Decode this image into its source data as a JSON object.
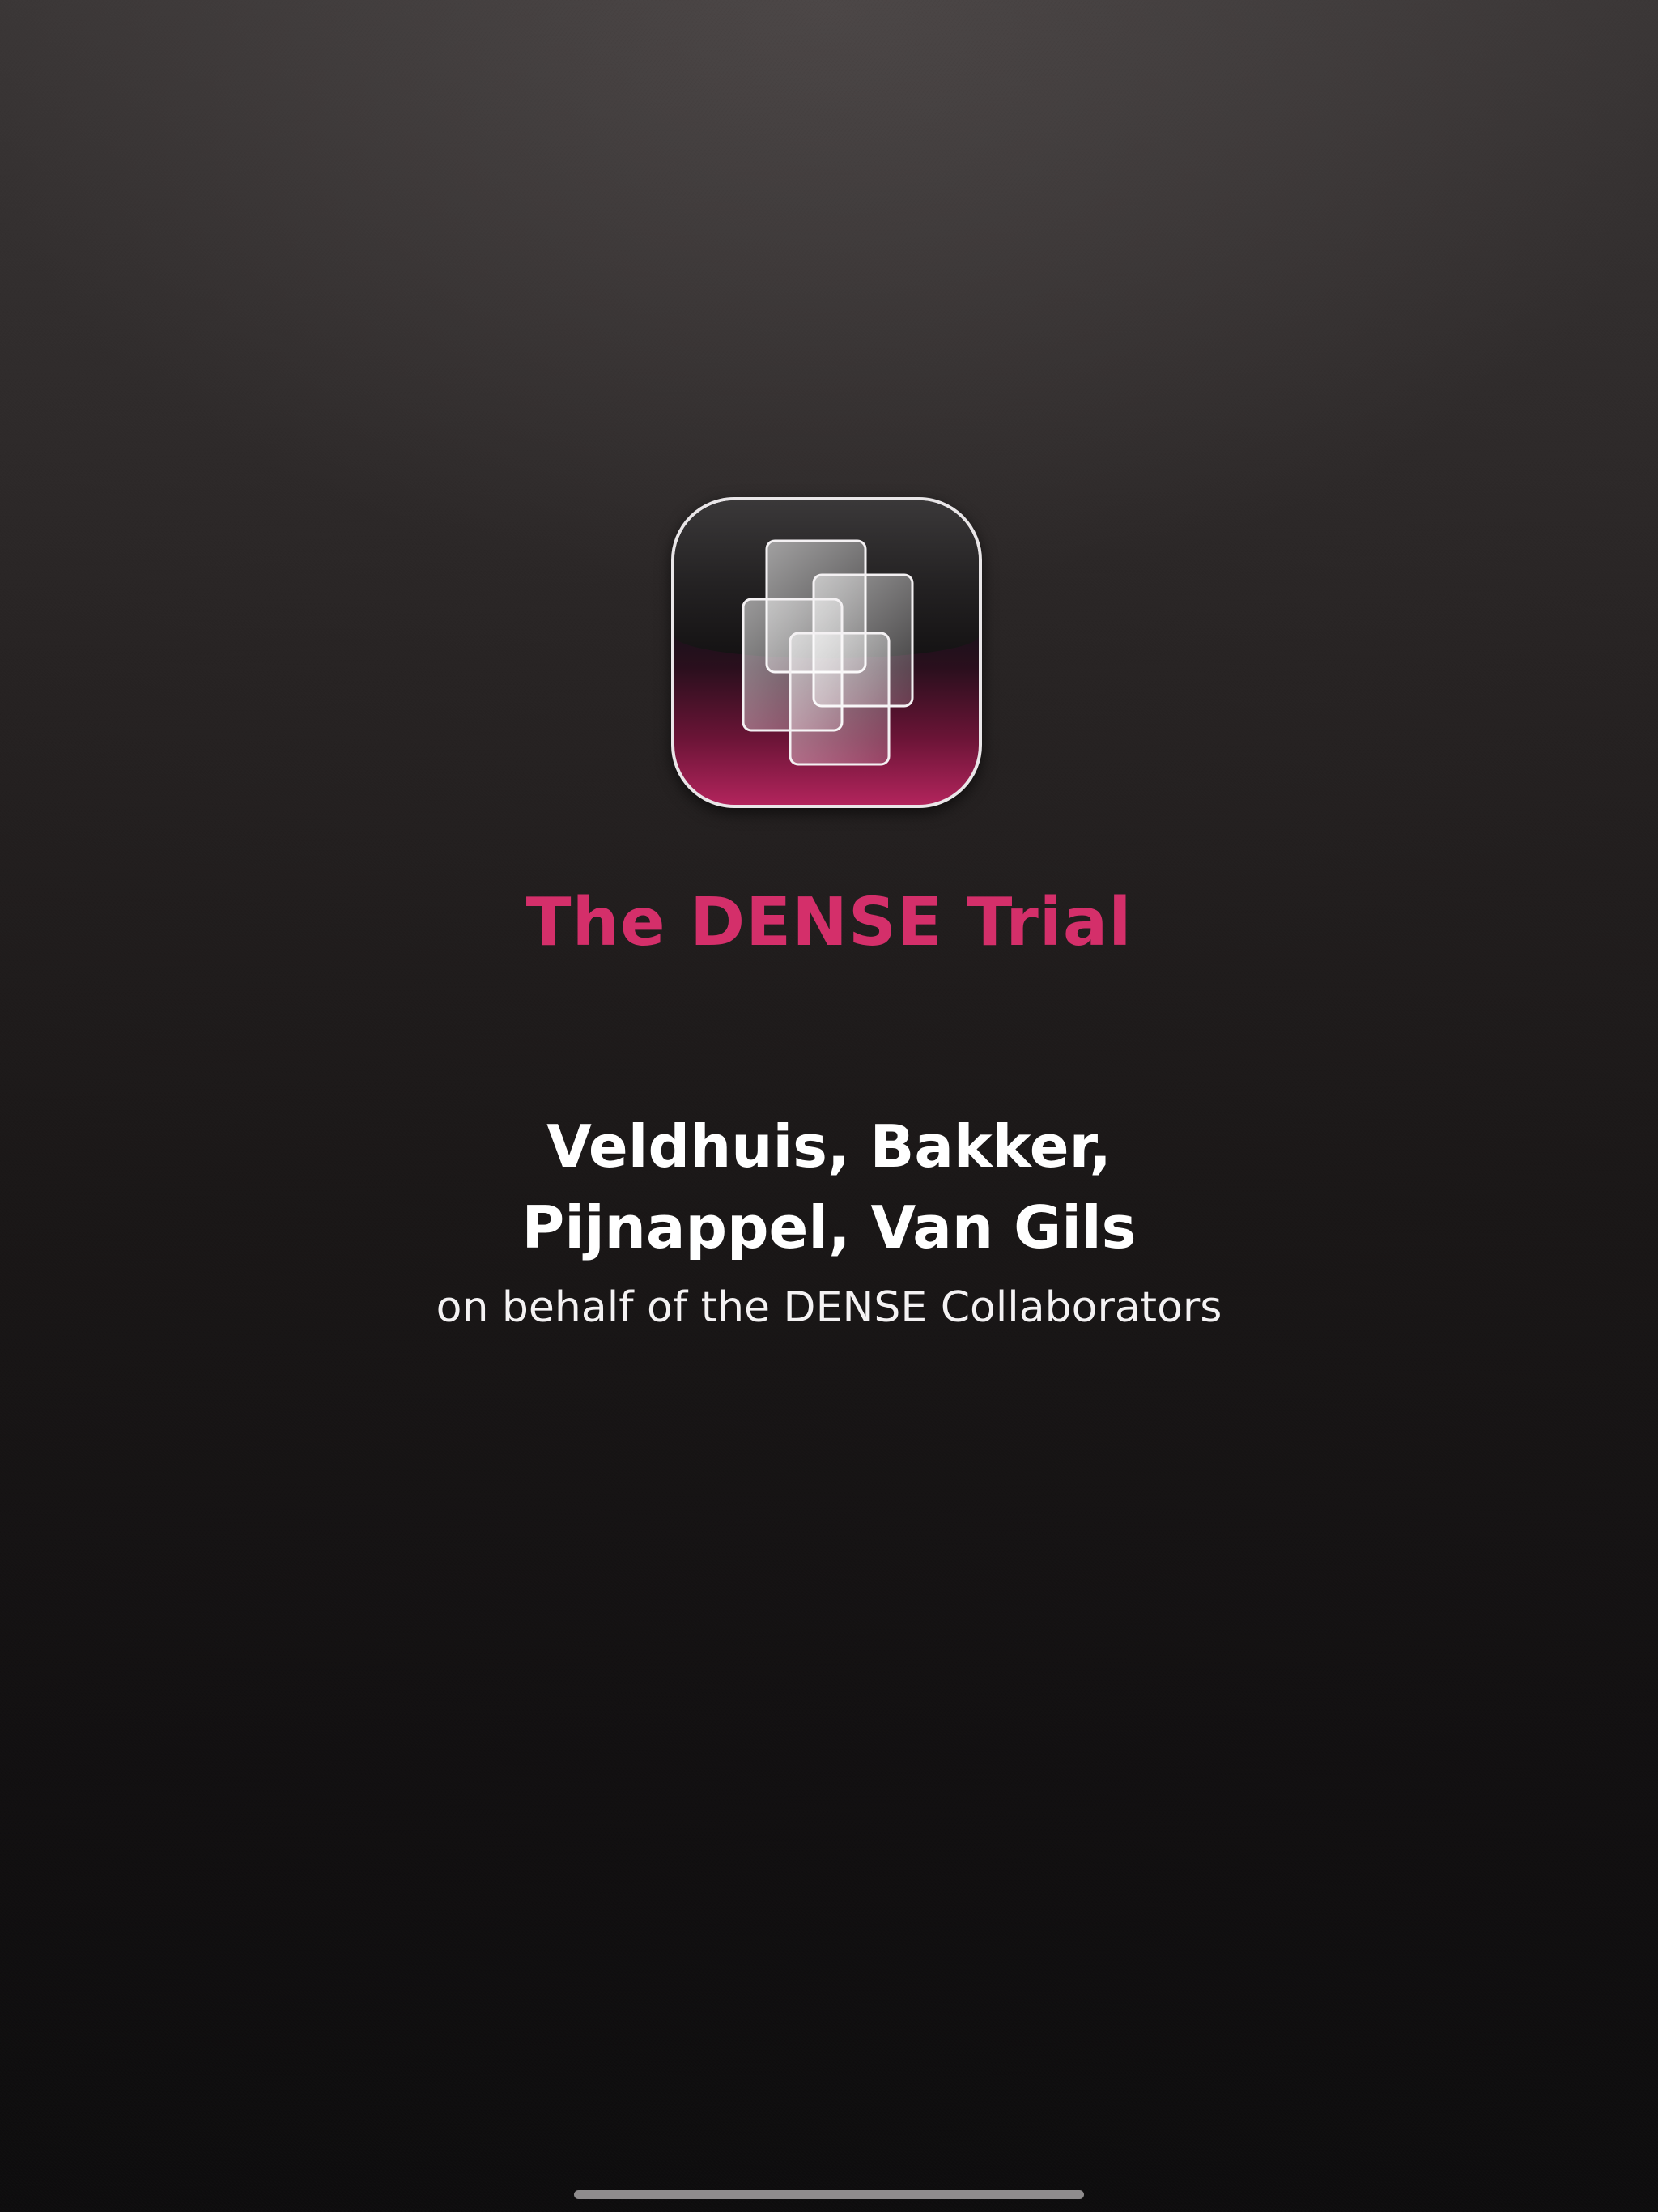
{
  "app_icon": {
    "name": "dense-trial-logo-icon",
    "accent_color": "#d42f6a"
  },
  "title": "The DENSE Trial",
  "authors": {
    "line1": "Veldhuis, Bakker,",
    "line2": "Pijnappel, Van Gils"
  },
  "subtitle": "on behalf of the DENSE Collaborators",
  "colors": {
    "title": "#d42f6a",
    "text": "#ffffff",
    "background_top": "#3b3737",
    "background_bottom": "#0e0d0e"
  }
}
